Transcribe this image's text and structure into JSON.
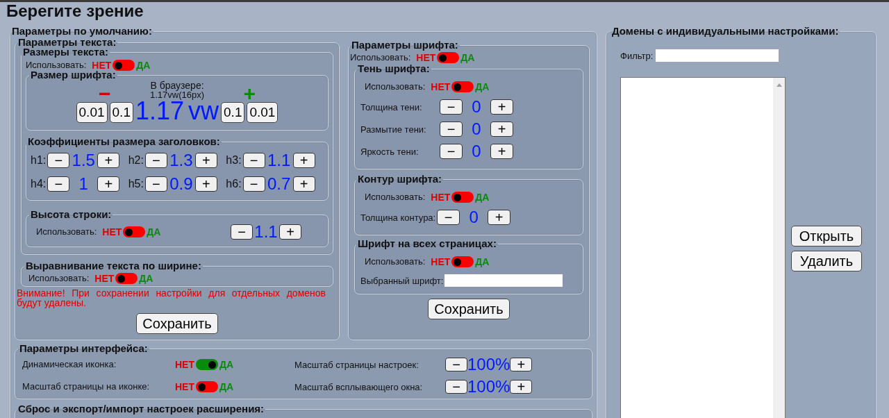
{
  "title": "Берегите зрение",
  "defaults": {
    "legend": "Параметры по умолчанию:",
    "text": {
      "legend": "Параметры текста:",
      "sizes": {
        "legend": "Размеры текста:",
        "use": {
          "label": "Использовать:",
          "no": "НЕТ",
          "yes": "ДА",
          "checked": false
        },
        "font_size": {
          "legend": "Размер шрифта:",
          "decrease_sign": "−",
          "increase_sign": "+",
          "browser_label": "В браузере:",
          "browser_value": "1.17vw(16px)",
          "decrease_buttons": [
            "0.01",
            "0.1"
          ],
          "value": "1.17",
          "unit": "vw",
          "increase_buttons": [
            "0.1",
            "0.01"
          ]
        },
        "headings": {
          "legend": "Коэффициенты размера заголовков:",
          "items": [
            {
              "label": "h1:",
              "minus": "−",
              "value": "1.5",
              "plus": "+"
            },
            {
              "label": "h2:",
              "minus": "−",
              "value": "1.3",
              "plus": "+"
            },
            {
              "label": "h3:",
              "minus": "−",
              "value": "1.1",
              "plus": "+"
            },
            {
              "label": "h4:",
              "minus": "−",
              "value": "1",
              "plus": "+"
            },
            {
              "label": "h5:",
              "minus": "−",
              "value": "0.9",
              "plus": "+"
            },
            {
              "label": "h6:",
              "minus": "−",
              "value": "0.7",
              "plus": "+"
            }
          ]
        },
        "line_height": {
          "legend": "Высота строки:",
          "use": {
            "label": "Использовать:",
            "no": "НЕТ",
            "yes": "ДА",
            "checked": false
          },
          "stepper": {
            "minus": "−",
            "value": "1.1",
            "plus": "+"
          }
        }
      },
      "justify": {
        "legend": "Выравнивание текста по ширине:",
        "use": {
          "label": "Использовать:",
          "no": "НЕТ",
          "yes": "ДА",
          "checked": false
        }
      },
      "warning": "Внимание! При сохранении настройки для отдельных доменов будут удалены.",
      "save": "Сохранить"
    },
    "font": {
      "legend": "Параметры шрифта:",
      "use": {
        "label": "Использовать:",
        "no": "НЕТ",
        "yes": "ДА",
        "checked": false
      },
      "shadow": {
        "legend": "Тень шрифта:",
        "use": {
          "label": "Использовать:",
          "no": "НЕТ",
          "yes": "ДА",
          "checked": false
        },
        "steppers": [
          {
            "label": "Толщина тени:",
            "minus": "−",
            "value": "0",
            "plus": "+"
          },
          {
            "label": "Размытие тени:",
            "minus": "−",
            "value": "0",
            "plus": "+"
          },
          {
            "label": "Яркость тени:",
            "minus": "−",
            "value": "0",
            "plus": "+"
          }
        ]
      },
      "outline": {
        "legend": "Контур шрифта:",
        "use": {
          "label": "Использовать:",
          "no": "НЕТ",
          "yes": "ДА",
          "checked": false
        },
        "steppers": [
          {
            "label": "Толщина контура:",
            "minus": "−",
            "value": "0",
            "plus": "+"
          }
        ]
      },
      "all_pages": {
        "legend": "Шрифт на всех страницах:",
        "use": {
          "label": "Использовать:",
          "no": "НЕТ",
          "yes": "ДА",
          "checked": false
        },
        "font_field": {
          "label": "Выбранный шрифт:"
        }
      },
      "save": "Сохранить"
    },
    "interface": {
      "legend": "Параметры интерфейса:",
      "toggles": [
        {
          "label": "Динамическая иконка:",
          "no": "НЕТ",
          "yes": "ДА",
          "checked": true
        },
        {
          "label": "Масштаб страницы на иконке:",
          "no": "НЕТ",
          "yes": "ДА",
          "checked": false
        }
      ],
      "steppers": [
        {
          "label": "Масштаб страницы настроек:",
          "minus": "−",
          "value": "100%",
          "plus": "+"
        },
        {
          "label": "Масштаб всплывающего окна:",
          "minus": "−",
          "value": "100%",
          "plus": "+"
        }
      ]
    },
    "reset": {
      "legend": "Сброс и экспорт/импорт настроек расширения:"
    }
  },
  "domains": {
    "legend": "Домены с индивидуальными настройками:",
    "filter": {
      "label": "Фильтр:"
    },
    "buttons": [
      "Открыть",
      "Удалить"
    ]
  }
}
